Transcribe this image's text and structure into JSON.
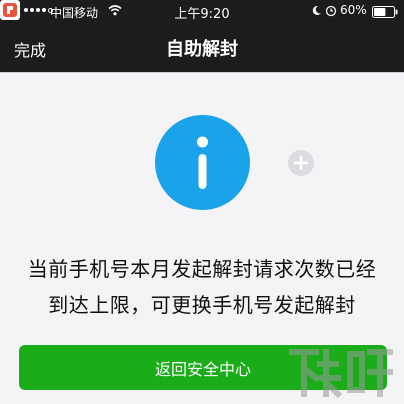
{
  "status_bar": {
    "carrier": "中国移动",
    "time": "上午9:20",
    "battery_percent": "60%",
    "signal_bars_filled": 4,
    "signal_bars_total": 5,
    "battery_level": 0.6
  },
  "nav_bar": {
    "left_action": "完成",
    "title": "自助解封"
  },
  "content": {
    "icon": "info-icon",
    "message": "当前手机号本月发起解封请求次数已经到达上限，可更换手机号发起解封"
  },
  "primary_button": {
    "label": "返回安全中心"
  },
  "colors": {
    "topbar_bg": "#1c1c1e",
    "page_bg": "#f4f4f6",
    "info_blue": "#1aa3e8",
    "button_green": "#1aad19"
  },
  "watermark": {
    "text": "下载吧"
  }
}
